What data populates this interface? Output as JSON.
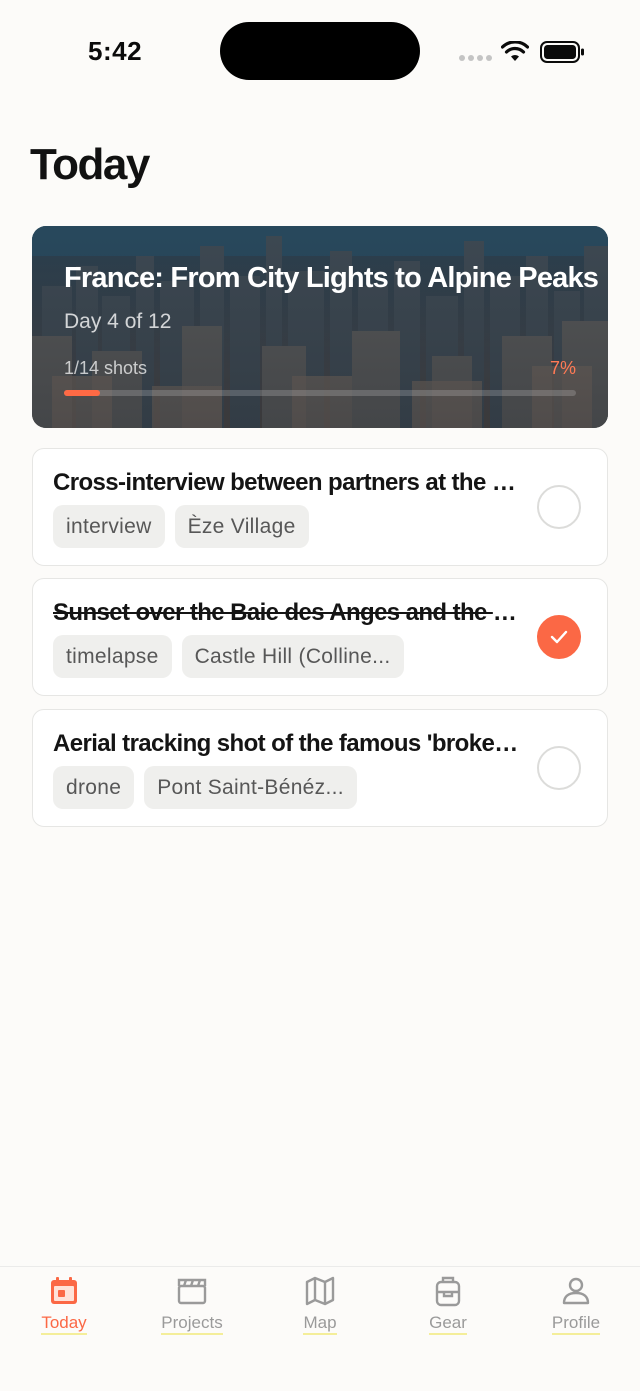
{
  "status_bar": {
    "time": "5:42"
  },
  "header": {
    "title": "Today"
  },
  "project": {
    "title": "France: From City Lights to Alpine Peaks",
    "subtitle": "Day 4 of 12",
    "shots_label": "1/14 shots",
    "percent_label": "7%",
    "progress": 0.07
  },
  "shots": [
    {
      "title": "Cross-interview between partners at the J...",
      "tags": [
        "interview",
        "Èze Village"
      ],
      "done": false
    },
    {
      "title": "Sunset over the Baie des Anges and the P...",
      "tags": [
        "timelapse",
        "Castle Hill (Colline..."
      ],
      "done": true
    },
    {
      "title": "Aerial tracking shot of the famous 'broken...",
      "tags": [
        "drone",
        "Pont Saint-Bénéz..."
      ],
      "done": false
    }
  ],
  "tabs": [
    {
      "label": "Today",
      "icon": "calendar-icon",
      "active": true
    },
    {
      "label": "Projects",
      "icon": "clapperboard-icon",
      "active": false
    },
    {
      "label": "Map",
      "icon": "map-icon",
      "active": false
    },
    {
      "label": "Gear",
      "icon": "backpack-icon",
      "active": false
    },
    {
      "label": "Profile",
      "icon": "person-icon",
      "active": false
    }
  ],
  "colors": {
    "accent": "#fb6845",
    "background": "#fcfbf9",
    "inactive": "#9a9a9a"
  }
}
